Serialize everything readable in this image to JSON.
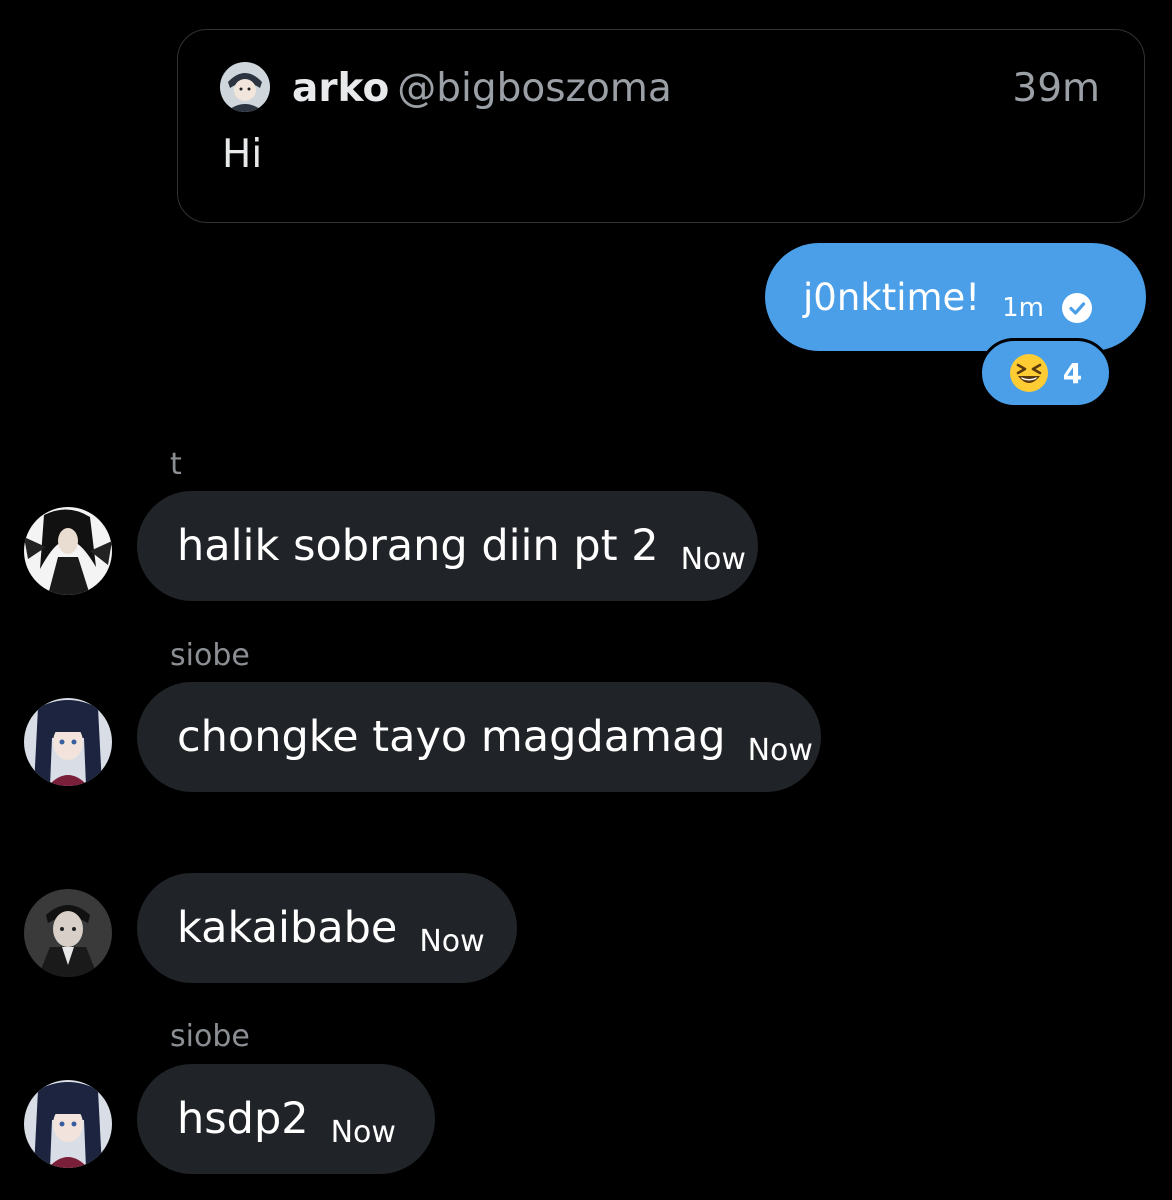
{
  "quoted_message": {
    "name": "arko",
    "handle": "@bigboszoma",
    "time": "39m",
    "text": "Hi"
  },
  "sent_message": {
    "text": "j0nktime!",
    "time": "1m",
    "status_icon": "check-circle-icon",
    "accent_color": "#4a9fe8"
  },
  "reaction": {
    "emoji": "grinning-squinting-face",
    "count": "4"
  },
  "messages": [
    {
      "sender": "t",
      "text": "halik sobrang diin pt 2",
      "time": "Now"
    },
    {
      "sender": "siobe",
      "text": "chongke tayo magdamag",
      "time": "Now"
    },
    {
      "sender": "",
      "text": "kakaibabe",
      "time": "Now"
    },
    {
      "sender": "siobe",
      "text": "hsdp2",
      "time": "Now"
    }
  ]
}
